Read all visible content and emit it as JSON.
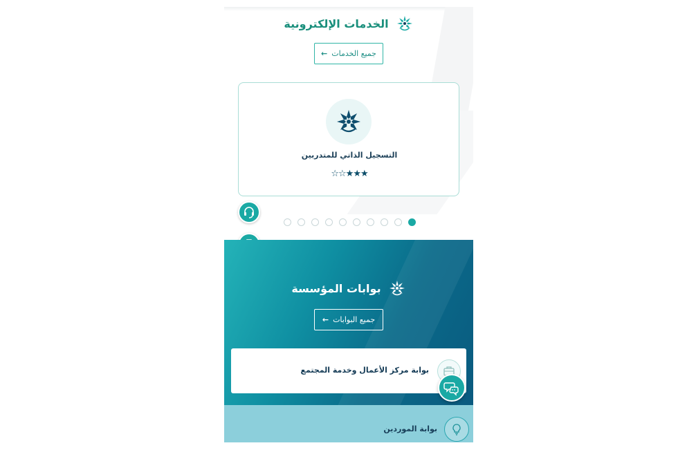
{
  "eservices": {
    "title": "الخدمات الإلكترونية",
    "all_button_label": "جميع الخدمات",
    "card": {
      "title": "التسجيل الذاتي للمتدربين",
      "rating": "★★★☆☆",
      "rating_value": 3,
      "rating_max": 5
    },
    "carousel": {
      "total": 10,
      "active_index": 0
    }
  },
  "portals": {
    "title": "بوابات المؤسسة",
    "all_button_label": "جميع البوابات",
    "cards": [
      {
        "title": "بوابة مركز الأعمال وخدمة المجتمع",
        "icon": "briefcase-icon"
      },
      {
        "title": "بوابة الموردين",
        "icon": "lightbulb-icon"
      }
    ]
  },
  "side_buttons": [
    "headset-icon",
    "briefcase-icon",
    "chat-bubbles-icon"
  ],
  "colors": {
    "title_green": "#1a8f7c",
    "title_navy": "#123f5b",
    "accent_teal": "#1aa9a4",
    "portals_bg_start": "#24b3b8",
    "portals_bg_end": "#0a5a7f",
    "suppliers_bg": "#8ccfdb"
  }
}
